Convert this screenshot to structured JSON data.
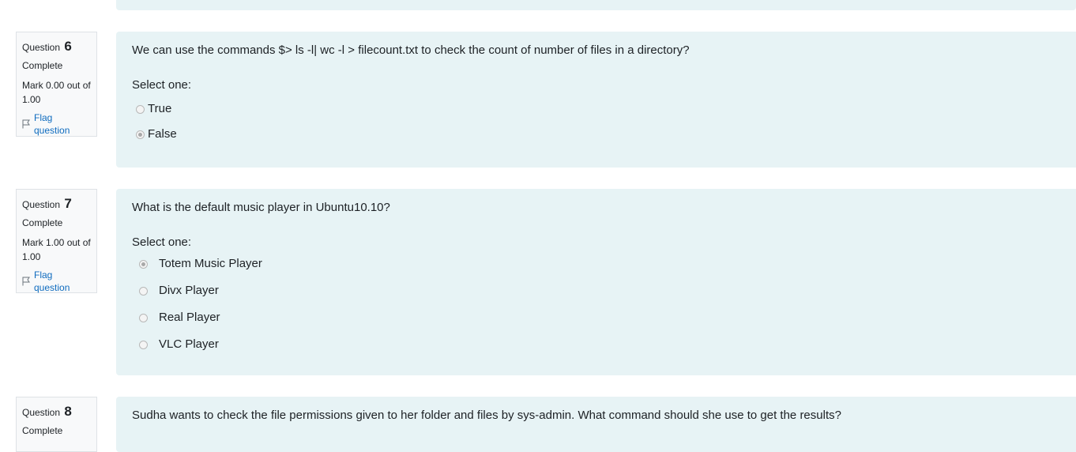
{
  "questions": [
    {
      "label": "Question",
      "number": "6",
      "state": "Complete",
      "grade": "Mark 0.00 out of 1.00",
      "flag": "Flag question",
      "text": "We can use the commands $> ls -l| wc -l > filecount.txt to check the count of number of files in a directory?",
      "prompt": "Select one:",
      "options": [
        "True",
        "False"
      ],
      "selected": "False"
    },
    {
      "label": "Question",
      "number": "7",
      "state": "Complete",
      "grade": "Mark 1.00 out of 1.00",
      "flag": "Flag question",
      "text": "What is the default music player in Ubuntu10.10?",
      "prompt": "Select one:",
      "options": [
        "Totem Music Player",
        "Divx Player",
        "Real Player",
        "VLC Player"
      ],
      "selected": "Totem Music Player"
    },
    {
      "label": "Question",
      "number": "8",
      "state": "Complete",
      "text": "Sudha wants to check the file permissions given to her folder and files by sys-admin. What command should she use to get the results?"
    }
  ],
  "colors": {
    "content_bg": "#e7f3f5",
    "info_bg": "#f8f9fa",
    "link": "#0f6cbf"
  }
}
